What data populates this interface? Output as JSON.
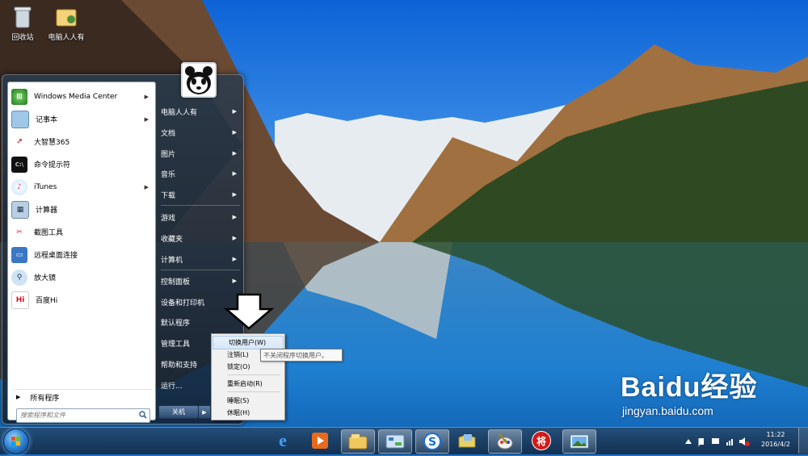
{
  "desktop": {
    "icons": [
      {
        "label": "回收站",
        "icon": "recycle-bin-icon"
      },
      {
        "label": "电脑人人有",
        "icon": "user-folder-icon"
      }
    ]
  },
  "start_menu": {
    "programs": [
      {
        "label": "Windows Media Center",
        "icon": "media-center-icon",
        "has_submenu": true
      },
      {
        "label": "记事本",
        "icon": "notepad-icon",
        "has_submenu": true
      },
      {
        "label": "大智慧365",
        "icon": "dazhihui-icon",
        "has_submenu": false
      },
      {
        "label": "命令提示符",
        "icon": "cmd-icon",
        "has_submenu": false
      },
      {
        "label": "iTunes",
        "icon": "itunes-icon",
        "has_submenu": true
      },
      {
        "label": "计算器",
        "icon": "calculator-icon",
        "has_submenu": false
      },
      {
        "label": "截图工具",
        "icon": "snipping-tool-icon",
        "has_submenu": false
      },
      {
        "label": "远程桌面连接",
        "icon": "remote-desktop-icon",
        "has_submenu": false
      },
      {
        "label": "放大镜",
        "icon": "magnifier-icon",
        "has_submenu": false
      },
      {
        "label": "百度Hi",
        "icon": "baidu-hi-icon",
        "has_submenu": false
      }
    ],
    "all_programs": "所有程序",
    "search_placeholder": "搜索程序和文件",
    "right_items": [
      {
        "label": "电脑人人有",
        "has_submenu": true
      },
      {
        "label": "文档",
        "has_submenu": true
      },
      {
        "label": "图片",
        "has_submenu": true
      },
      {
        "label": "音乐",
        "has_submenu": true
      },
      {
        "label": "下载",
        "has_submenu": true
      },
      {
        "label": "游戏",
        "has_submenu": true
      },
      {
        "label": "收藏夹",
        "has_submenu": true
      },
      {
        "label": "计算机",
        "has_submenu": true
      },
      {
        "label": "控制面板",
        "has_submenu": true
      },
      {
        "label": "设备和打印机",
        "has_submenu": false
      },
      {
        "label": "默认程序",
        "has_submenu": false
      },
      {
        "label": "管理工具",
        "has_submenu": false
      },
      {
        "label": "帮助和支持",
        "has_submenu": false
      },
      {
        "label": "运行...",
        "has_submenu": false
      }
    ],
    "shutdown_label": "关机"
  },
  "power_menu": {
    "items": [
      {
        "label": "切换用户(W)",
        "highlighted": true
      },
      {
        "label": "注销(L)",
        "highlighted": false
      },
      {
        "label": "锁定(O)",
        "highlighted": false
      },
      {
        "label": "重新启动(R)",
        "highlighted": false
      },
      {
        "label": "睡眠(S)",
        "highlighted": false
      },
      {
        "label": "休眠(H)",
        "highlighted": false
      }
    ],
    "tooltip": "不关闭程序切换用户。"
  },
  "taskbar": {
    "buttons": [
      {
        "icon": "internet-explorer-icon"
      },
      {
        "icon": "media-player-icon"
      },
      {
        "icon": "file-explorer-icon"
      },
      {
        "icon": "control-panel-icon"
      },
      {
        "icon": "sogou-icon"
      },
      {
        "icon": "folder-icon"
      },
      {
        "icon": "paint-icon"
      },
      {
        "icon": "chinese-chess-icon",
        "text": "将"
      },
      {
        "icon": "picture-viewer-icon"
      }
    ],
    "clock": {
      "time": "11:22",
      "date": "2016/4/2"
    }
  },
  "watermark": {
    "brand": "Baidu经验",
    "url": "jingyan.baidu.com"
  },
  "colors": {
    "accent": "#1d6fc4",
    "menu_dark": "#22344a",
    "highlight": "#d7e7f8"
  }
}
